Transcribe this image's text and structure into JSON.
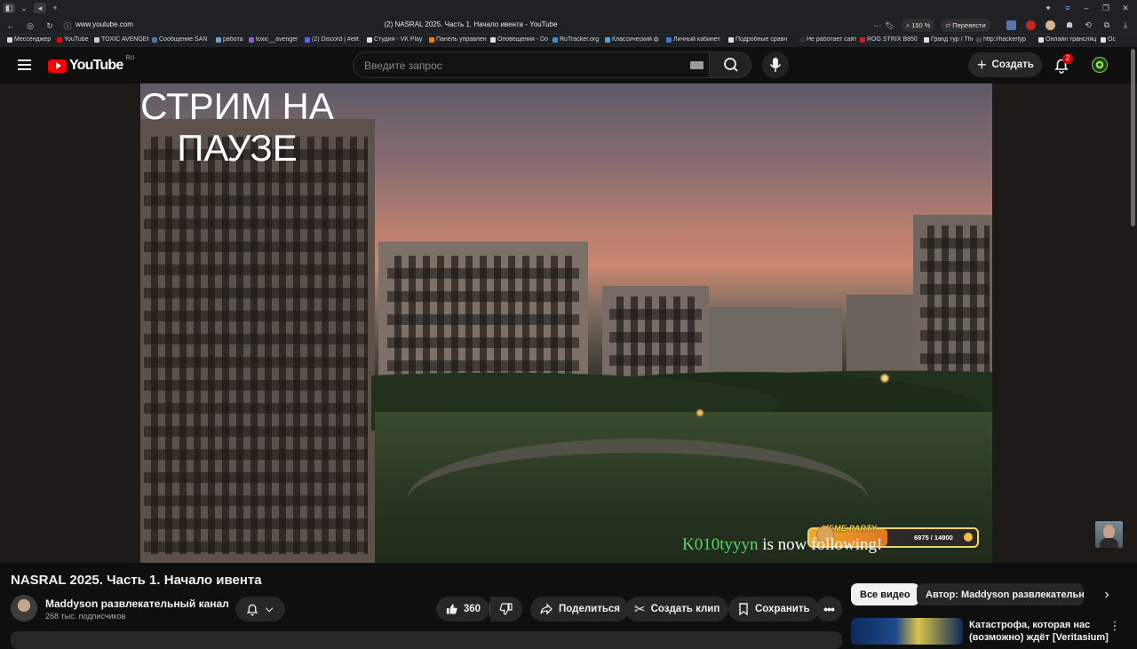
{
  "browser": {
    "url": "www.youtube.com",
    "tab_title": "(2) NASRAL 2025. Часть 1. Начало ивента - YouTube",
    "zoom": "150 %",
    "translate": "Перевести"
  },
  "bookmarks": [
    "Мессенджер",
    "YouTube",
    "TOXIC AVENGER",
    "Сообщение SAN",
    "работа",
    "toxic__avenger",
    "(2) Discord | #elit",
    "Студия - VK Play",
    "Панель управлен",
    "Оповещения - Do",
    "RuTracker.org",
    "Классический ф",
    "Личный кабинет",
    "Подробные сравн",
    "Не работает сайт",
    "ROG STRIX B850",
    "Гранд тур / The G",
    "http://hackertyp",
    "Онлайн трансляц",
    "Ос"
  ],
  "header": {
    "logo_text": "YouTube",
    "region": "RU",
    "search_placeholder": "Введите запрос",
    "create_label": "Создать",
    "notif_count": "2"
  },
  "video": {
    "paused_text": "СТРИМ НА ПАУЗЕ",
    "follow_name": "K010tyyyn",
    "follow_text": "is now following!",
    "meme_label": "MEME PARTY",
    "meme_progress": "6975 / 14900",
    "meme_fraction": 0.468
  },
  "info": {
    "title": "NASRAL 2025. Часть 1. Начало ивента",
    "channel": "Maddyson развлекательный канал",
    "subscribers": "268 тыс. подписчиков",
    "likes": "360",
    "share": "Поделиться",
    "clip": "Создать клип",
    "save": "Сохранить"
  },
  "sidebar": {
    "chip_all": "Все видео",
    "chip_author": "Автор: Maddyson развлекательный",
    "next_video_title": "Катастрофа, которая нас (возможно) ждёт [Veritasium]"
  },
  "colors": {
    "accent": "#ff0000",
    "follow_name": "#5fd36a",
    "meme_border": "#f0d470"
  }
}
